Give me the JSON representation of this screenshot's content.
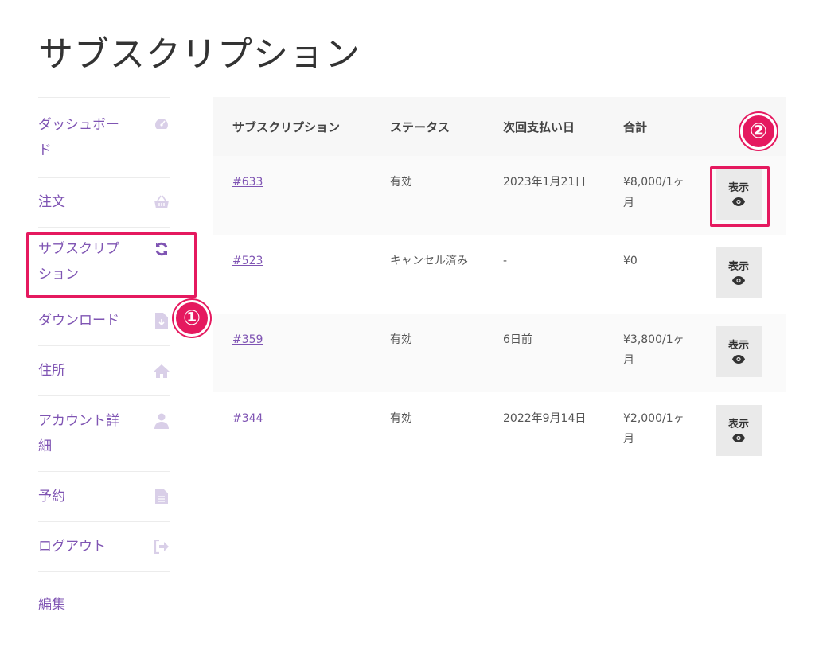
{
  "page": {
    "title": "サブスクリプション"
  },
  "sidebar": {
    "items": [
      {
        "label": "ダッシュボード",
        "icon": "dashboard-icon"
      },
      {
        "label": "注文",
        "icon": "basket-icon"
      },
      {
        "label": "サブスクリプション",
        "icon": "refresh-icon",
        "active": true
      },
      {
        "label": "ダウンロード",
        "icon": "file-download-icon"
      },
      {
        "label": "住所",
        "icon": "home-icon"
      },
      {
        "label": "アカウント詳細",
        "icon": "user-icon"
      },
      {
        "label": "予約",
        "icon": "document-icon"
      },
      {
        "label": "ログアウト",
        "icon": "logout-icon"
      },
      {
        "label": "編集",
        "icon": ""
      }
    ]
  },
  "table": {
    "headers": [
      "サブスクリプション",
      "ステータス",
      "次回支払い日",
      "合計",
      ""
    ],
    "rows": [
      {
        "id": "#633",
        "status": "有効",
        "next_payment": "2023年1月21日",
        "total": "¥8,000/1ヶ月",
        "action": "表示"
      },
      {
        "id": "#523",
        "status": "キャンセル済み",
        "next_payment": "-",
        "total": "¥0",
        "action": "表示"
      },
      {
        "id": "#359",
        "status": "有効",
        "next_payment": "6日前",
        "total": "¥3,800/1ヶ月",
        "action": "表示"
      },
      {
        "id": "#344",
        "status": "有効",
        "next_payment": "2022年9月14日",
        "total": "¥2,000/1ヶ月",
        "action": "表示"
      }
    ]
  },
  "annotations": {
    "badge_1": "①",
    "badge_2": "②",
    "color": "#e5195f"
  },
  "colors": {
    "accent": "#7f54b3",
    "icon_muted": "#d9cfe8"
  }
}
